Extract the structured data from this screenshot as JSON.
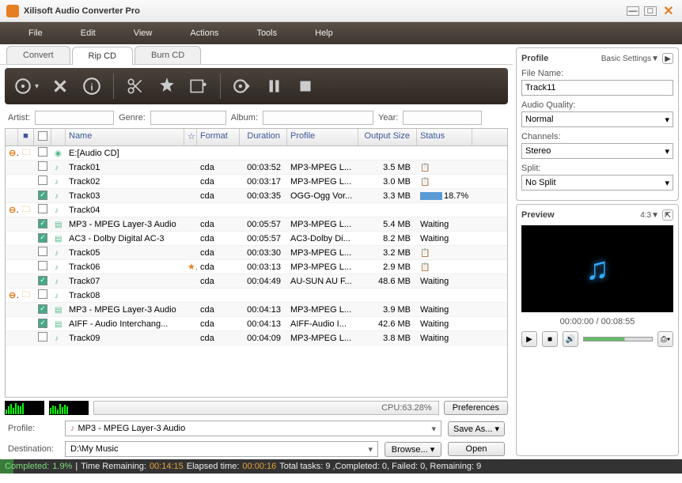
{
  "app": {
    "title": "Xilisoft Audio Converter Pro"
  },
  "menu": [
    "File",
    "Edit",
    "View",
    "Actions",
    "Tools",
    "Help"
  ],
  "tabs": [
    {
      "label": "Convert",
      "active": false
    },
    {
      "label": "Rip CD",
      "active": true
    },
    {
      "label": "Burn CD",
      "active": false
    }
  ],
  "filters": {
    "artist_label": "Artist:",
    "artist": "",
    "genre_label": "Genre:",
    "genre": "",
    "album_label": "Album:",
    "album": "",
    "year_label": "Year:",
    "year": ""
  },
  "columns": {
    "name": "Name",
    "format": "Format",
    "duration": "Duration",
    "profile": "Profile",
    "output": "Output Size",
    "status": "Status"
  },
  "rows": [
    {
      "expand": "-",
      "folder": true,
      "chk": "off",
      "icon": "cd",
      "name": "E:[Audio CD]",
      "fmt": "",
      "dur": "",
      "prof": "",
      "out": "",
      "status": "",
      "star": false
    },
    {
      "chk": "off",
      "icon": "track",
      "name": "Track01",
      "fmt": "cda",
      "dur": "00:03:52",
      "prof": "MP3-MPEG L...",
      "out": "3.5 MB",
      "status": "clip"
    },
    {
      "chk": "off",
      "icon": "track",
      "name": "Track02",
      "fmt": "cda",
      "dur": "00:03:17",
      "prof": "MP3-MPEG L...",
      "out": "3.0 MB",
      "status": "clip"
    },
    {
      "chk": "on",
      "icon": "track",
      "name": "Track03",
      "fmt": "cda",
      "dur": "00:03:35",
      "prof": "OGG-Ogg Vor...",
      "out": "3.3 MB",
      "status": "progress",
      "progress": "18.7%"
    },
    {
      "expand": "-",
      "folder": true,
      "chk": "off",
      "icon": "track",
      "name": "Track04",
      "fmt": "",
      "dur": "",
      "prof": "",
      "out": "",
      "status": ""
    },
    {
      "indent": true,
      "chk": "on",
      "icon": "prof",
      "name": "MP3 - MPEG Layer-3 Audio",
      "fmt": "cda",
      "dur": "00:05:57",
      "prof": "MP3-MPEG L...",
      "out": "5.4 MB",
      "status": "Waiting"
    },
    {
      "indent": true,
      "chk": "on",
      "icon": "prof",
      "name": "AC3 - Dolby Digital AC-3",
      "fmt": "cda",
      "dur": "00:05:57",
      "prof": "AC3-Dolby Di...",
      "out": "8.2 MB",
      "status": "Waiting"
    },
    {
      "chk": "off",
      "icon": "track",
      "name": "Track05",
      "fmt": "cda",
      "dur": "00:03:30",
      "prof": "MP3-MPEG L...",
      "out": "3.2 MB",
      "status": "clip"
    },
    {
      "chk": "off",
      "icon": "track",
      "name": "Track06",
      "fmt": "cda",
      "dur": "00:03:13",
      "prof": "MP3-MPEG L...",
      "out": "2.9 MB",
      "status": "clip",
      "star": true
    },
    {
      "chk": "on",
      "icon": "track",
      "name": "Track07",
      "fmt": "cda",
      "dur": "00:04:49",
      "prof": "AU-SUN AU F...",
      "out": "48.6 MB",
      "status": "Waiting"
    },
    {
      "expand": "-",
      "folder": true,
      "chk": "off",
      "icon": "track",
      "name": "Track08",
      "fmt": "",
      "dur": "",
      "prof": "",
      "out": "",
      "status": ""
    },
    {
      "indent": true,
      "chk": "on",
      "icon": "prof",
      "name": "MP3 - MPEG Layer-3 Audio",
      "fmt": "cda",
      "dur": "00:04:13",
      "prof": "MP3-MPEG L...",
      "out": "3.9 MB",
      "status": "Waiting"
    },
    {
      "indent": true,
      "chk": "on",
      "icon": "prof",
      "name": "AIFF - Audio Interchang...",
      "fmt": "cda",
      "dur": "00:04:13",
      "prof": "AIFF-Audio I...",
      "out": "42.6 MB",
      "status": "Waiting"
    },
    {
      "chk": "off",
      "icon": "track",
      "name": "Track09",
      "fmt": "cda",
      "dur": "00:04:09",
      "prof": "MP3-MPEG L...",
      "out": "3.8 MB",
      "status": "Waiting"
    }
  ],
  "cpu": {
    "label": "CPU:63.28%",
    "pref": "Preferences"
  },
  "profile_row": {
    "label": "Profile:",
    "value": "MP3 - MPEG Layer-3 Audio",
    "save": "Save As..."
  },
  "dest_row": {
    "label": "Destination:",
    "value": "D:\\My Music",
    "browse": "Browse...",
    "open": "Open"
  },
  "status": {
    "completed_label": "Completed:",
    "completed": "1.9%",
    "sep": " | ",
    "remaining_label": "Time Remaining:",
    "remaining": "00:14:15",
    "elapsed_label": " Elapsed time:",
    "elapsed": "00:00:16",
    "tasks": " Total tasks: 9 ,Completed: 0, Failed: 0, Remaining: 9"
  },
  "profile_panel": {
    "title": "Profile",
    "settings": "Basic Settings▼",
    "filename_label": "File Name:",
    "filename": "Track11",
    "quality_label": "Audio Quality:",
    "quality": "Normal",
    "channels_label": "Channels:",
    "channels": "Stereo",
    "split_label": "Split:",
    "split": "No Split"
  },
  "preview": {
    "title": "Preview",
    "ratio": "4:3▼",
    "time": "00:00:00 / 00:08:55"
  }
}
